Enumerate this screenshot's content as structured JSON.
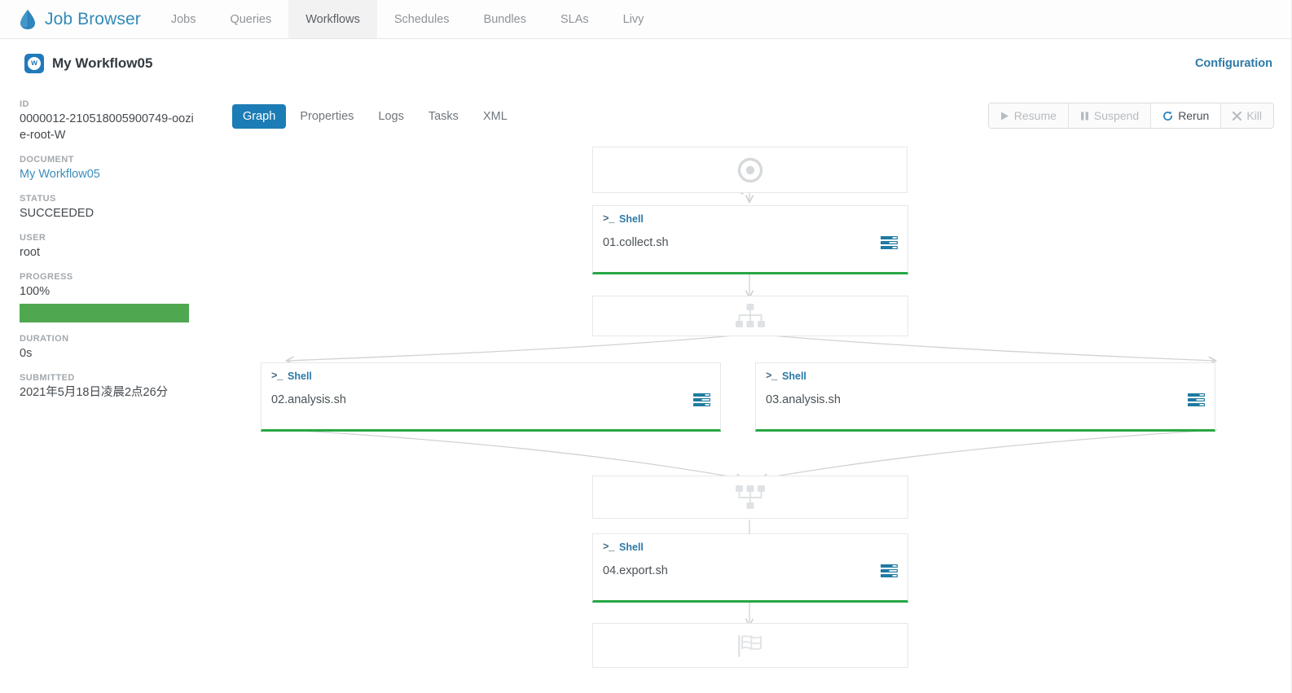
{
  "app": {
    "brand": "Job Browser",
    "brand_logo_icon": "hue-droplet-logo",
    "accent_blue": "#2c7aa8",
    "tab_active_blue": "#1c7cb5",
    "success_green": "#28a745",
    "progress_green": "#4fa84f"
  },
  "topnav": {
    "items": [
      {
        "label": "Jobs",
        "active": false
      },
      {
        "label": "Queries",
        "active": false
      },
      {
        "label": "Workflows",
        "active": true
      },
      {
        "label": "Schedules",
        "active": false
      },
      {
        "label": "Bundles",
        "active": false
      },
      {
        "label": "SLAs",
        "active": false
      },
      {
        "label": "Livy",
        "active": false
      }
    ]
  },
  "header": {
    "badge_letter": "w",
    "title": "My Workflow05",
    "configuration_label": "Configuration"
  },
  "sidebar": {
    "id_label": "ID",
    "id_value": "0000012-210518005900749-oozie-root-W",
    "document_label": "DOCUMENT",
    "document_value": "My Workflow05",
    "status_label": "STATUS",
    "status_value": "SUCCEEDED",
    "user_label": "USER",
    "user_value": "root",
    "progress_label": "PROGRESS",
    "progress_value": "100%",
    "progress_percent": 100,
    "duration_label": "DURATION",
    "duration_value": "0s",
    "submitted_label": "SUBMITTED",
    "submitted_value": "2021年5月18日凌晨2点26分"
  },
  "tabs": [
    {
      "label": "Graph",
      "active": true
    },
    {
      "label": "Properties",
      "active": false
    },
    {
      "label": "Logs",
      "active": false
    },
    {
      "label": "Tasks",
      "active": false
    },
    {
      "label": "XML",
      "active": false
    }
  ],
  "actions": [
    {
      "label": "Resume",
      "icon": "play-icon",
      "enabled": false
    },
    {
      "label": "Suspend",
      "icon": "pause-icon",
      "enabled": false
    },
    {
      "label": "Rerun",
      "icon": "refresh-icon",
      "enabled": true
    },
    {
      "label": "Kill",
      "icon": "close-x-icon",
      "enabled": false
    }
  ],
  "graph": {
    "nodes": [
      {
        "id": "start",
        "kind": "control",
        "icon": "start-target-icon"
      },
      {
        "id": "shell1",
        "kind": "action",
        "type_label": "Shell",
        "prompt": ">_",
        "name": "01.collect.sh",
        "logs_icon": "logs-icon",
        "status_color": "#28a745"
      },
      {
        "id": "fork",
        "kind": "control",
        "icon": "fork-sitemap-icon"
      },
      {
        "id": "shell2",
        "kind": "action",
        "type_label": "Shell",
        "prompt": ">_",
        "name": "02.analysis.sh",
        "logs_icon": "logs-icon",
        "status_color": "#28a745"
      },
      {
        "id": "shell3",
        "kind": "action",
        "type_label": "Shell",
        "prompt": ">_",
        "name": "03.analysis.sh",
        "logs_icon": "logs-icon",
        "status_color": "#28a745"
      },
      {
        "id": "join",
        "kind": "control",
        "icon": "join-sitemap-icon"
      },
      {
        "id": "shell4",
        "kind": "action",
        "type_label": "Shell",
        "prompt": ">_",
        "name": "04.export.sh",
        "logs_icon": "logs-icon",
        "status_color": "#28a745"
      },
      {
        "id": "end",
        "kind": "control",
        "icon": "end-flag-icon"
      }
    ]
  }
}
